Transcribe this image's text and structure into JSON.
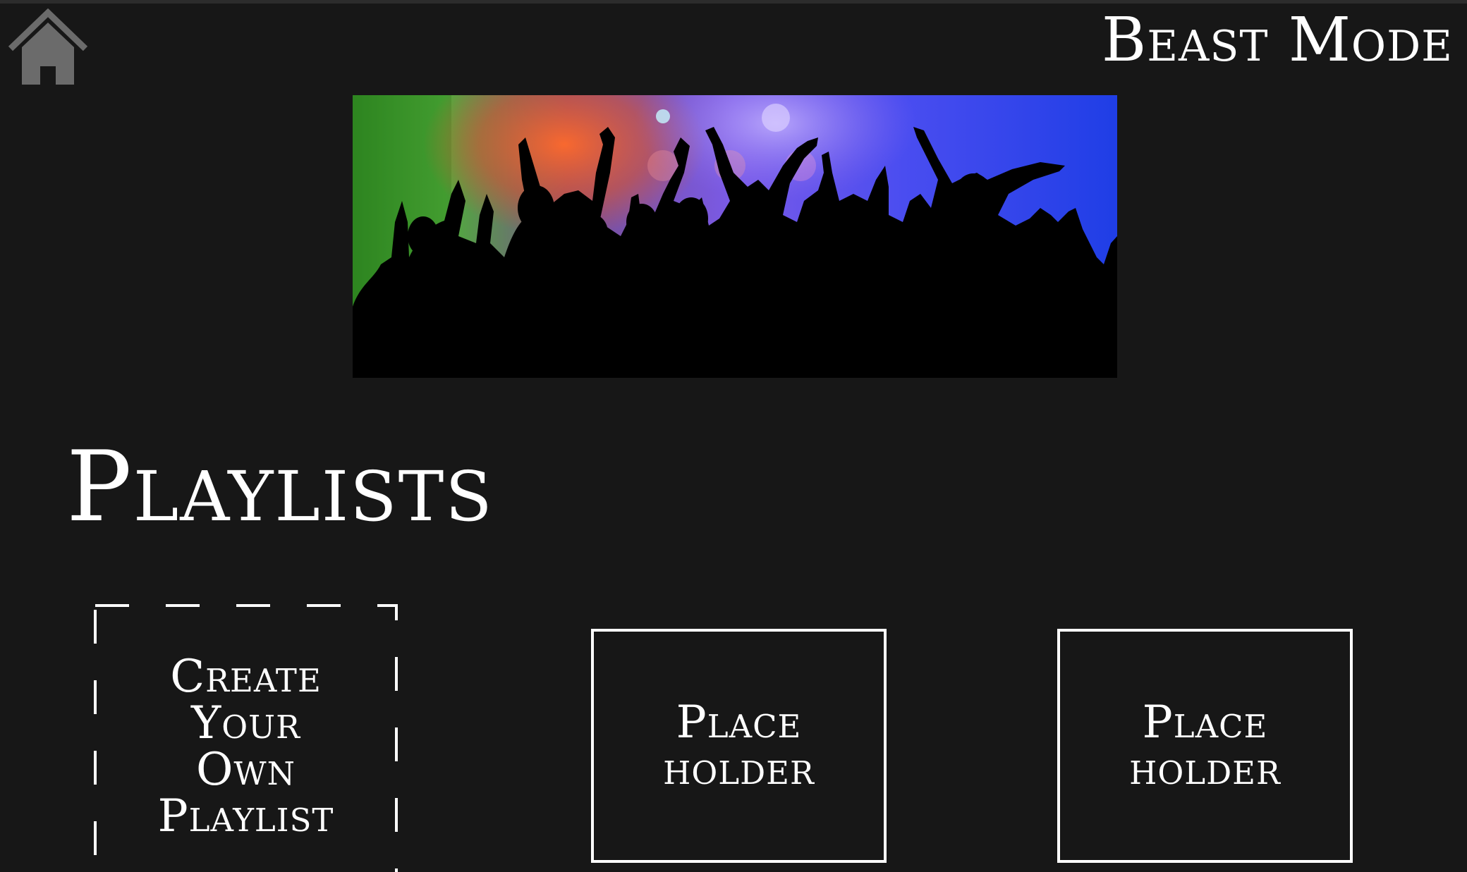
{
  "app": {
    "brand": "Beast Mode"
  },
  "header": {
    "home_icon": "home-icon"
  },
  "hero": {
    "image": "concert-crowd-silhouette",
    "colors": {
      "green": "#3fb03a",
      "orange": "#e8572c",
      "purple": "#8a5cf0",
      "blue": "#2a45e8"
    }
  },
  "playlists": {
    "title": "Playlists",
    "create_tile": {
      "lines": [
        "Create",
        "Your",
        "Own",
        "Playlist"
      ]
    },
    "tiles": [
      {
        "lines": [
          "Place",
          "holder"
        ]
      },
      {
        "lines": [
          "Place",
          "holder"
        ]
      }
    ]
  },
  "colors": {
    "background": "#171717",
    "text": "#ffffff",
    "home_icon": "#6b6b6b"
  }
}
